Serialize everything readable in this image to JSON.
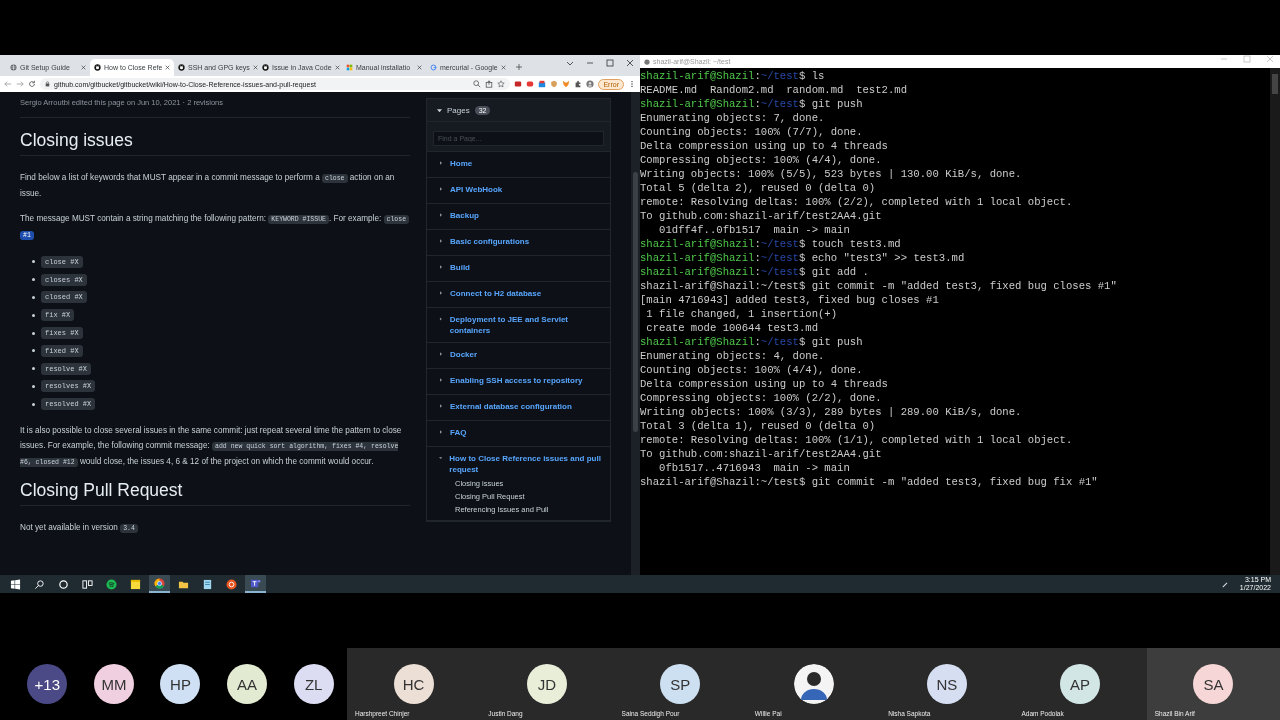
{
  "browser": {
    "tabs": [
      {
        "title": "Git Setup Guide",
        "kind": "globe",
        "selected": false
      },
      {
        "title": "How to Close Refe",
        "kind": "github",
        "selected": true
      },
      {
        "title": "SSH and GPG keys",
        "kind": "github",
        "selected": false
      },
      {
        "title": "Issue in Java Code",
        "kind": "github",
        "selected": false
      },
      {
        "title": "Manual installatio",
        "kind": "windows",
        "selected": false
      },
      {
        "title": "mercurial - Google",
        "kind": "google",
        "selected": false
      }
    ],
    "url": "github.com/gitbucket/gitbucket/wiki/How-to-Close-Reference-issues-and-pull-request",
    "extension_button": "Error"
  },
  "wiki": {
    "edit_info": "Sergio Arroutbi edited this page on Jun 10, 2021 · 2 revisions",
    "blocks": [
      {
        "kind": "heading",
        "text": "Closing issues"
      },
      {
        "kind": "paragraph",
        "segments": [
          {
            "kind": "text",
            "text": "Find below a list of keywords that MUST appear in a commit message to perform a "
          },
          {
            "kind": "code",
            "text": "close"
          },
          {
            "kind": "text",
            "text": " action on an issue."
          }
        ]
      },
      {
        "kind": "paragraph",
        "segments": [
          {
            "kind": "text",
            "text": "The message MUST contain a string matching the following pattern: "
          },
          {
            "kind": "code",
            "text": "KEYWORD #ISSUE"
          },
          {
            "kind": "text",
            "text": ". For example: "
          },
          {
            "kind": "code",
            "text": "close "
          },
          {
            "kind": "code-selected",
            "text": "#1"
          }
        ]
      },
      {
        "kind": "list",
        "items": [
          "close #X",
          "closes #X",
          "closed #X",
          "fix #X",
          "fixes #X",
          "fixed #X",
          "resolve #X",
          "resolves #X",
          "resolved #X"
        ]
      },
      {
        "kind": "paragraph",
        "segments": [
          {
            "kind": "text",
            "text": "It is also possible to close several issues in the same commit: just repeat several time the pattern to close issues. For example, the following commit message: "
          },
          {
            "kind": "code",
            "text": "add new quick sort algorithm, fixes #4, resolve #6, closed #12"
          },
          {
            "kind": "text",
            "text": " would close, the issues 4, 6 & 12 of the project on which the commit would occur."
          }
        ]
      },
      {
        "kind": "heading",
        "text": "Closing Pull Request"
      },
      {
        "kind": "paragraph",
        "segments": [
          {
            "kind": "text",
            "text": "Not yet available in version "
          },
          {
            "kind": "code",
            "text": "3.4"
          }
        ]
      }
    ]
  },
  "sidebar": {
    "title": "Pages",
    "count": "32",
    "expanded": true,
    "search_placeholder": "Find a Page...",
    "pages": [
      {
        "label": "Home",
        "expanded": false
      },
      {
        "label": "API WebHook",
        "expanded": false
      },
      {
        "label": "Backup",
        "expanded": false
      },
      {
        "label": "Basic configurations",
        "expanded": false
      },
      {
        "label": "Build",
        "expanded": false
      },
      {
        "label": "Connect to H2 database",
        "expanded": false
      },
      {
        "label": "Deployment to JEE and Servlet containers",
        "expanded": false
      },
      {
        "label": "Docker",
        "expanded": false
      },
      {
        "label": "Enabling SSH access to repository",
        "expanded": false
      },
      {
        "label": "External database configuration",
        "expanded": false
      },
      {
        "label": "FAQ",
        "expanded": false
      },
      {
        "label": "How to Close Reference issues and pull request",
        "expanded": true,
        "children": [
          {
            "label": "Closing issues"
          },
          {
            "label": "Closing Pull Request"
          },
          {
            "label": "Referencing Issues and Pull"
          }
        ]
      }
    ]
  },
  "terminal": {
    "title": "shazil-arif@Shazil: ~/test",
    "lines": [
      {
        "kind": "prompt",
        "user": "shazil-arif@Shazil",
        "path": "~/test",
        "separator": ":",
        "command": "$ ls"
      },
      {
        "kind": "output",
        "text": "README.md  Random2.md  random.md  test2.md"
      },
      {
        "kind": "prompt",
        "user": "shazil-arif@Shazil",
        "path": "~/test",
        "separator": ":",
        "command": "$ git push"
      },
      {
        "kind": "output",
        "text": "Enumerating objects: 7, done."
      },
      {
        "kind": "output",
        "text": "Counting objects: 100% (7/7), done."
      },
      {
        "kind": "output",
        "text": "Delta compression using up to 4 threads"
      },
      {
        "kind": "output",
        "text": "Compressing objects: 100% (4/4), done."
      },
      {
        "kind": "output",
        "text": "Writing objects: 100% (5/5), 523 bytes | 130.00 KiB/s, done."
      },
      {
        "kind": "output",
        "text": "Total 5 (delta 2), reused 0 (delta 0)"
      },
      {
        "kind": "output",
        "text": "remote: Resolving deltas: 100% (2/2), completed with 1 local object."
      },
      {
        "kind": "output",
        "text": "To github.com:shazil-arif/test2AA4.git"
      },
      {
        "kind": "output",
        "text": "   01dff4f..0fb1517  main -> main"
      },
      {
        "kind": "prompt",
        "user": "shazil-arif@Shazil",
        "path": "~/test",
        "separator": ":",
        "command": "$ touch test3.md"
      },
      {
        "kind": "prompt",
        "user": "shazil-arif@Shazil",
        "path": "~/test",
        "separator": ":",
        "command": "$ echo \"test3\" >> test3.md"
      },
      {
        "kind": "prompt",
        "user": "shazil-arif@Shazil",
        "path": "~/test",
        "separator": ":",
        "command": "$ git add ."
      },
      {
        "kind": "output",
        "text": "shazil-arif@Shazil:~/test$ git commit -m \"added test3, fixed bug closes #1\""
      },
      {
        "kind": "output",
        "text": "[main 4716943] added test3, fixed bug closes #1"
      },
      {
        "kind": "output",
        "text": " 1 file changed, 1 insertion(+)"
      },
      {
        "kind": "output",
        "text": " create mode 100644 test3.md"
      },
      {
        "kind": "prompt",
        "user": "shazil-arif@Shazil",
        "path": "~/test",
        "separator": ":",
        "command": "$ git push"
      },
      {
        "kind": "output",
        "text": "Enumerating objects: 4, done."
      },
      {
        "kind": "output",
        "text": "Counting objects: 100% (4/4), done."
      },
      {
        "kind": "output",
        "text": "Delta compression using up to 4 threads"
      },
      {
        "kind": "output",
        "text": "Compressing objects: 100% (2/2), done."
      },
      {
        "kind": "output",
        "text": "Writing objects: 100% (3/3), 289 bytes | 289.00 KiB/s, done."
      },
      {
        "kind": "output",
        "text": "Total 3 (delta 1), reused 0 (delta 0)"
      },
      {
        "kind": "output",
        "text": "remote: Resolving deltas: 100% (1/1), completed with 1 local object."
      },
      {
        "kind": "output",
        "text": "To github.com:shazil-arif/test2AA4.git"
      },
      {
        "kind": "output",
        "text": "   0fb1517..4716943  main -> main"
      },
      {
        "kind": "output",
        "text": "shazil-arif@Shazil:~/test$ git commit -m \"added test3, fixed bug fix #1\""
      }
    ]
  },
  "taskbar": {
    "apps": [
      {
        "kind": "start",
        "active": false
      },
      {
        "kind": "search",
        "active": false
      },
      {
        "kind": "cortana",
        "active": false
      },
      {
        "kind": "taskview",
        "active": false
      },
      {
        "kind": "music",
        "active": false
      },
      {
        "kind": "notes",
        "active": false
      },
      {
        "kind": "browser",
        "active": true
      },
      {
        "kind": "folder",
        "active": false
      },
      {
        "kind": "app",
        "active": false
      },
      {
        "kind": "linux",
        "active": false
      },
      {
        "kind": "teams",
        "active": true
      }
    ],
    "time": "3:15 PM",
    "date": "1/27/2022"
  },
  "meeting": {
    "participants": [
      {
        "kind": "overflow",
        "initials": "+13",
        "color": "#4b4a86"
      },
      {
        "kind": "overflow",
        "initials": "MM",
        "color": "#f0cfe0"
      },
      {
        "kind": "overflow",
        "initials": "HP",
        "color": "#cfe0f4"
      },
      {
        "kind": "overflow",
        "initials": "AA",
        "color": "#e2ead2"
      },
      {
        "kind": "overflow",
        "initials": "ZL",
        "color": "#dcdcf2"
      },
      {
        "kind": "tile",
        "initials": "HC",
        "name": "Harshpreet Chinjer",
        "color": "#ecdfd6"
      },
      {
        "kind": "tile",
        "initials": "JD",
        "name": "Justin Dang",
        "color": "#e8eed8"
      },
      {
        "kind": "tile",
        "initials": "SP",
        "name": "Saina Seddigh Pour",
        "color": "#cce0f2"
      },
      {
        "kind": "photo",
        "name": "Willie Pai"
      },
      {
        "kind": "tile",
        "initials": "NS",
        "name": "Nisha Sapkota",
        "color": "#d6def2"
      },
      {
        "kind": "tile",
        "initials": "AP",
        "name": "Adam Podolak",
        "color": "#d2e6e6"
      },
      {
        "kind": "tile",
        "initials": "SA",
        "name": "Shazil Bin Arif",
        "color": "#f6d6d6"
      }
    ]
  }
}
